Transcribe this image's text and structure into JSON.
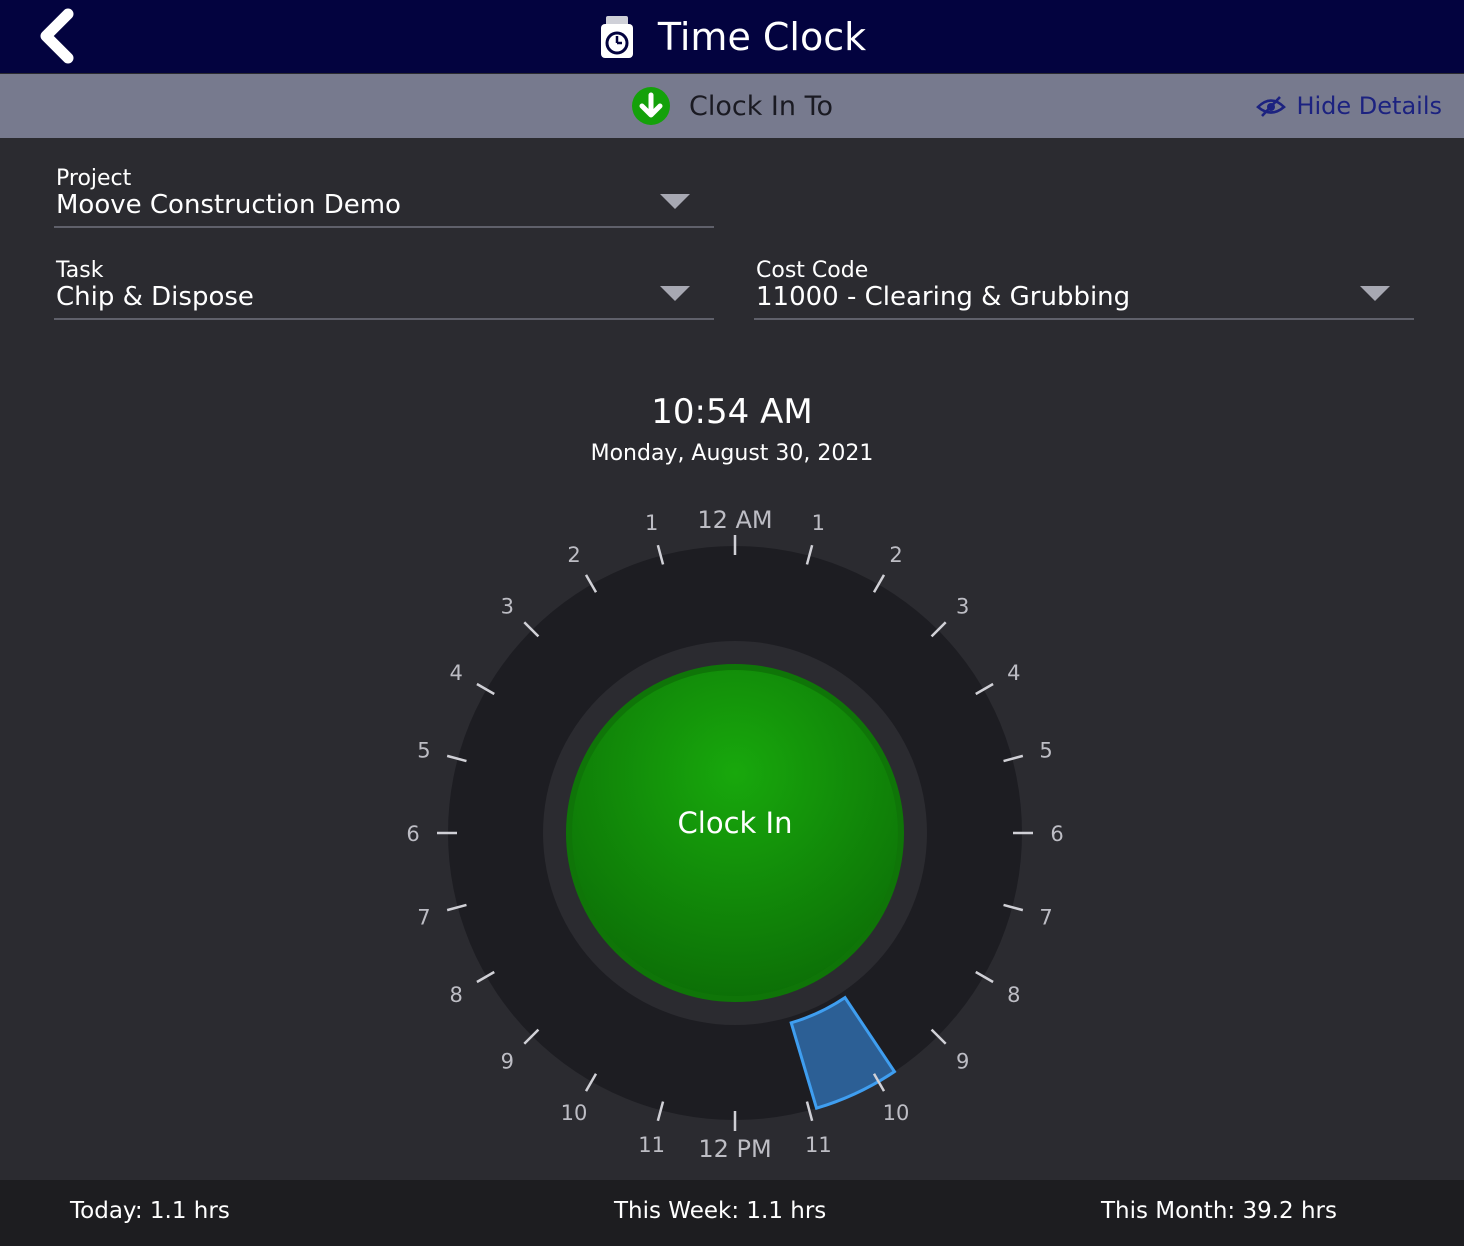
{
  "header": {
    "title": "Time Clock",
    "back_icon": "chevron-left-icon",
    "title_icon": "timeclock-icon"
  },
  "subheader": {
    "label": "Clock In To",
    "label_icon": "green-down-arrow-icon",
    "hide_details": "Hide Details",
    "hide_icon": "eye-slash-icon"
  },
  "fields": {
    "project": {
      "label": "Project",
      "value": "Moove Construction Demo"
    },
    "task": {
      "label": "Task",
      "value": "Chip & Dispose"
    },
    "cost_code": {
      "label": "Cost Code",
      "value": "11000 - Clearing & Grubbing"
    }
  },
  "clock": {
    "time": "10:54 AM",
    "date": "Monday, August 30, 2021",
    "button_label": "Clock In",
    "top_label": "12 AM",
    "bottom_label": "12 PM",
    "right_hours": [
      "1",
      "2",
      "3",
      "4",
      "5",
      "6",
      "7",
      "8",
      "9",
      "10",
      "11"
    ],
    "left_hours": [
      "1",
      "2",
      "3",
      "4",
      "5",
      "6",
      "7",
      "8",
      "9",
      "10",
      "11"
    ],
    "worked_segment": {
      "start_hour": 9.75,
      "end_hour": 10.9,
      "color": "#2c5f95",
      "edge_color": "#3f9ef0"
    }
  },
  "footer": {
    "today": "Today: 1.1 hrs",
    "week": "This Week: 1.1 hrs",
    "month": "This Month: 39.2 hrs"
  },
  "colors": {
    "header_bg": "#03033f",
    "subheader_bg": "#777a8e",
    "body_bg": "#2b2b30",
    "button_green": "#129c07",
    "link_blue": "#1c2280"
  }
}
